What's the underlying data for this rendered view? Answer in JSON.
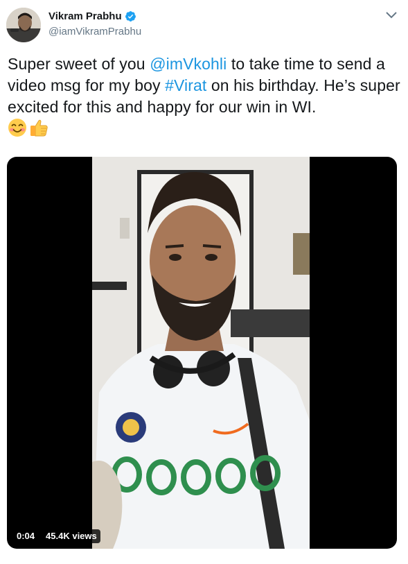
{
  "user": {
    "display_name": "Vikram Prabhu",
    "handle": "@iamVikramPrabhu",
    "verified": true,
    "avatar_icon": "profile-photo"
  },
  "tweet": {
    "segments": [
      {
        "text": "Super sweet of you ",
        "type": "text"
      },
      {
        "text": "@imVkohli",
        "type": "mention"
      },
      {
        "text": " to take time to send a video msg for my boy ",
        "type": "text"
      },
      {
        "text": "#Virat",
        "type": "hashtag"
      },
      {
        "text": " on his birthday. He’s super excited for this and happy for our win in WI.",
        "type": "text"
      }
    ],
    "emojis": [
      "smiling-face-icon",
      "thumbs-up-icon"
    ]
  },
  "video": {
    "duration": "0:04",
    "views": "45.4K views"
  },
  "colors": {
    "link": "#1b95e0",
    "verified": "#1da1f2",
    "secondary_text": "#657786"
  }
}
